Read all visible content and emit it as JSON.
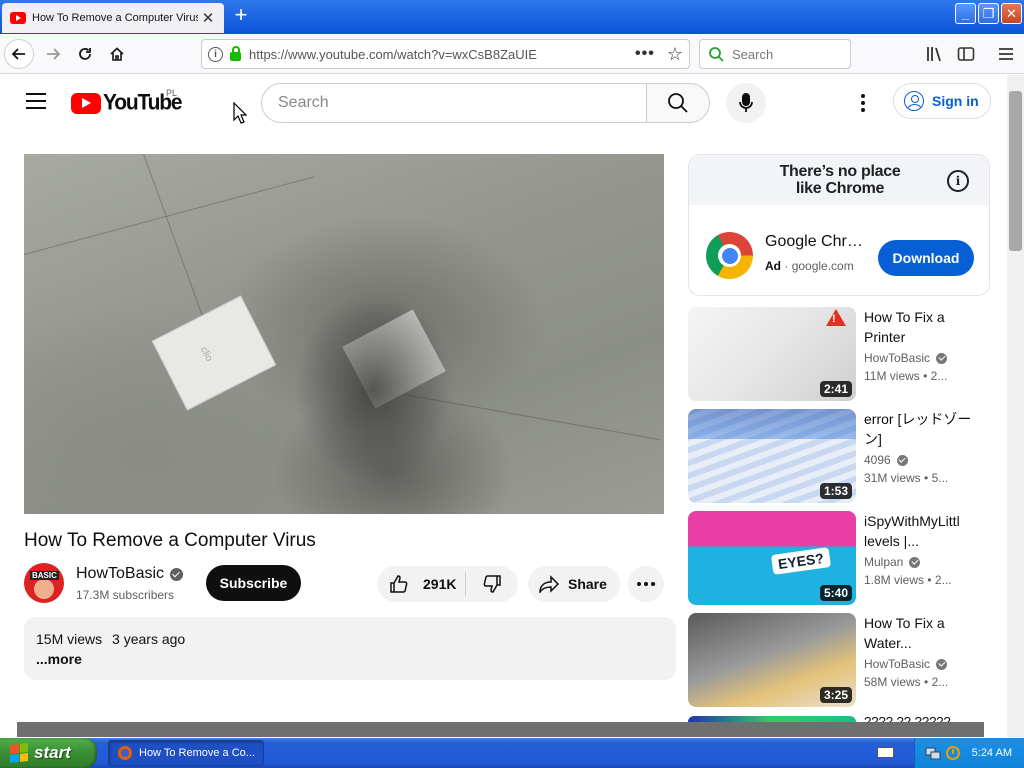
{
  "browser": {
    "tab_title": "How To Remove a Computer Virus",
    "tab_close": "✕",
    "new_tab": "+",
    "url": "https://www.youtube.com/watch?v=wxCsB8ZaUIE",
    "search_placeholder": "Search",
    "window_controls": [
      "_",
      "❐",
      "✕"
    ]
  },
  "youtube": {
    "logo_text": "YouTube",
    "region": "PL",
    "search_placeholder": "Search",
    "sign_in": "Sign in"
  },
  "video": {
    "title": "How To Remove a Computer Virus",
    "channel": "HowToBasic",
    "channel_avatar_text": "BASIC",
    "subscribers": "17.3M subscribers",
    "subscribe": "Subscribe",
    "likes": "291K",
    "share": "Share",
    "views": "15M views",
    "age": "3 years ago",
    "more": "...more",
    "frame_text": "clio"
  },
  "ad": {
    "banner": "There’s no place like Chrome",
    "title": "Google Chrome",
    "ad_label": "Ad",
    "separator": "·",
    "domain": "google.com",
    "cta": "Download",
    "info": "i"
  },
  "recommendations": [
    {
      "title": "How To Fix a Printer",
      "channel": "HowToBasic",
      "views": "11M views",
      "age": "• 2...",
      "duration": "2:41"
    },
    {
      "title": "error [レッドゾーン]",
      "channel": "4096",
      "views": "31M views",
      "age": "• 5...",
      "duration": "1:53"
    },
    {
      "title": "iSpyWithMyLittl levels |...",
      "channel": "Mulpan",
      "views": "1.8M views",
      "age": "• 2...",
      "duration": "5:40",
      "thumb_text": "EYES?"
    },
    {
      "title": "How To Fix a Water...",
      "channel": "HowToBasic",
      "views": "58M views",
      "age": "• 2...",
      "duration": "3:25"
    }
  ],
  "rec5_title": "???? ?? ?????",
  "taskbar": {
    "start": "start",
    "task": "How To Remove a Co...",
    "time": "5:24 AM"
  }
}
